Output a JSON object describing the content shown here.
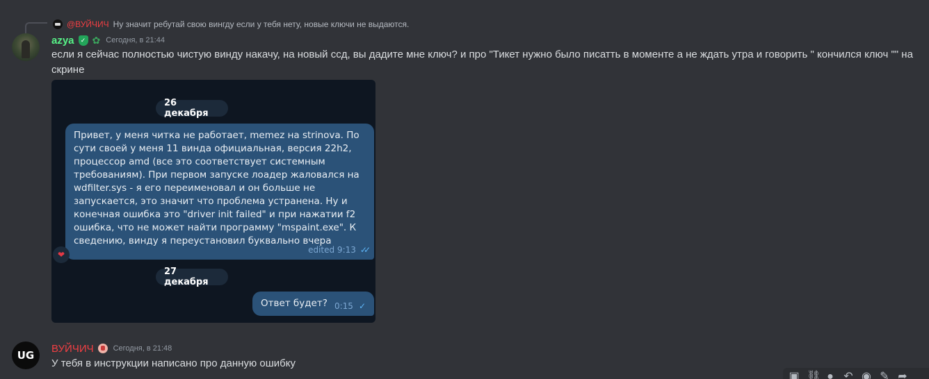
{
  "reply": {
    "mention": "@ВУЙЧИЧ",
    "text": "Ну значит ребутай свою вингду если у тебя нету, новые ключи не выдаются."
  },
  "messages": [
    {
      "username": "azya",
      "timestamp": "Сегодня, в 21:44",
      "text": "если я сейчас полностью чистую винду накачу, на новый ссд, вы дадите мне ключ? и про \"Тикет нужно было писатть в моменте а не ждать утра и говорить \" кончился ключ \"\" на скрине"
    },
    {
      "username": "ВУЙЧИЧ",
      "timestamp": "Сегодня, в 21:48",
      "text": "У тебя в инструкции написано про данную ошибку"
    }
  ],
  "avatar_ug_text": "UG",
  "screenshot": {
    "date1": "26 декабря",
    "bubble1": {
      "text": "Привет, у меня читка не работает, memez на strinova. По сути своей у меня 11 винда официальная, версия 22h2, процессор amd (все это соответствует системным требованиям). При первом запуске лоадер жаловался на wdfilter.sys - я его переименовал и он больше не запускается, это значит что проблема устранена. Ну и конечная ошибка это \"driver init failed\" и при нажатии f2 ошибка, что не может найти программу \"mspaint.exe\". К сведению, винду я переустановил буквально вчера",
      "meta": "edited 9:13",
      "reaction": "❤"
    },
    "date2": "27 декабря",
    "bubble2": {
      "text": "Ответ будет?",
      "time": "0:15"
    }
  },
  "icons": {
    "badge1": "shield-badge-icon",
    "badge2": "paw-badge-icon",
    "badge3": "seal-badge-icon",
    "checks": "double-check-icon",
    "check": "single-check-icon"
  },
  "toolbar": {
    "icons": [
      "add-app-icon",
      "link-icon",
      "emoji-icon",
      "reply-icon",
      "react-icon",
      "edit-icon",
      "forward-icon"
    ]
  },
  "colors": {
    "background": "#313338",
    "azya_name": "#57f287",
    "vuy_name": "#f23f43",
    "tg_bubble": "#2b5278",
    "tg_bg": "#0e1621"
  }
}
